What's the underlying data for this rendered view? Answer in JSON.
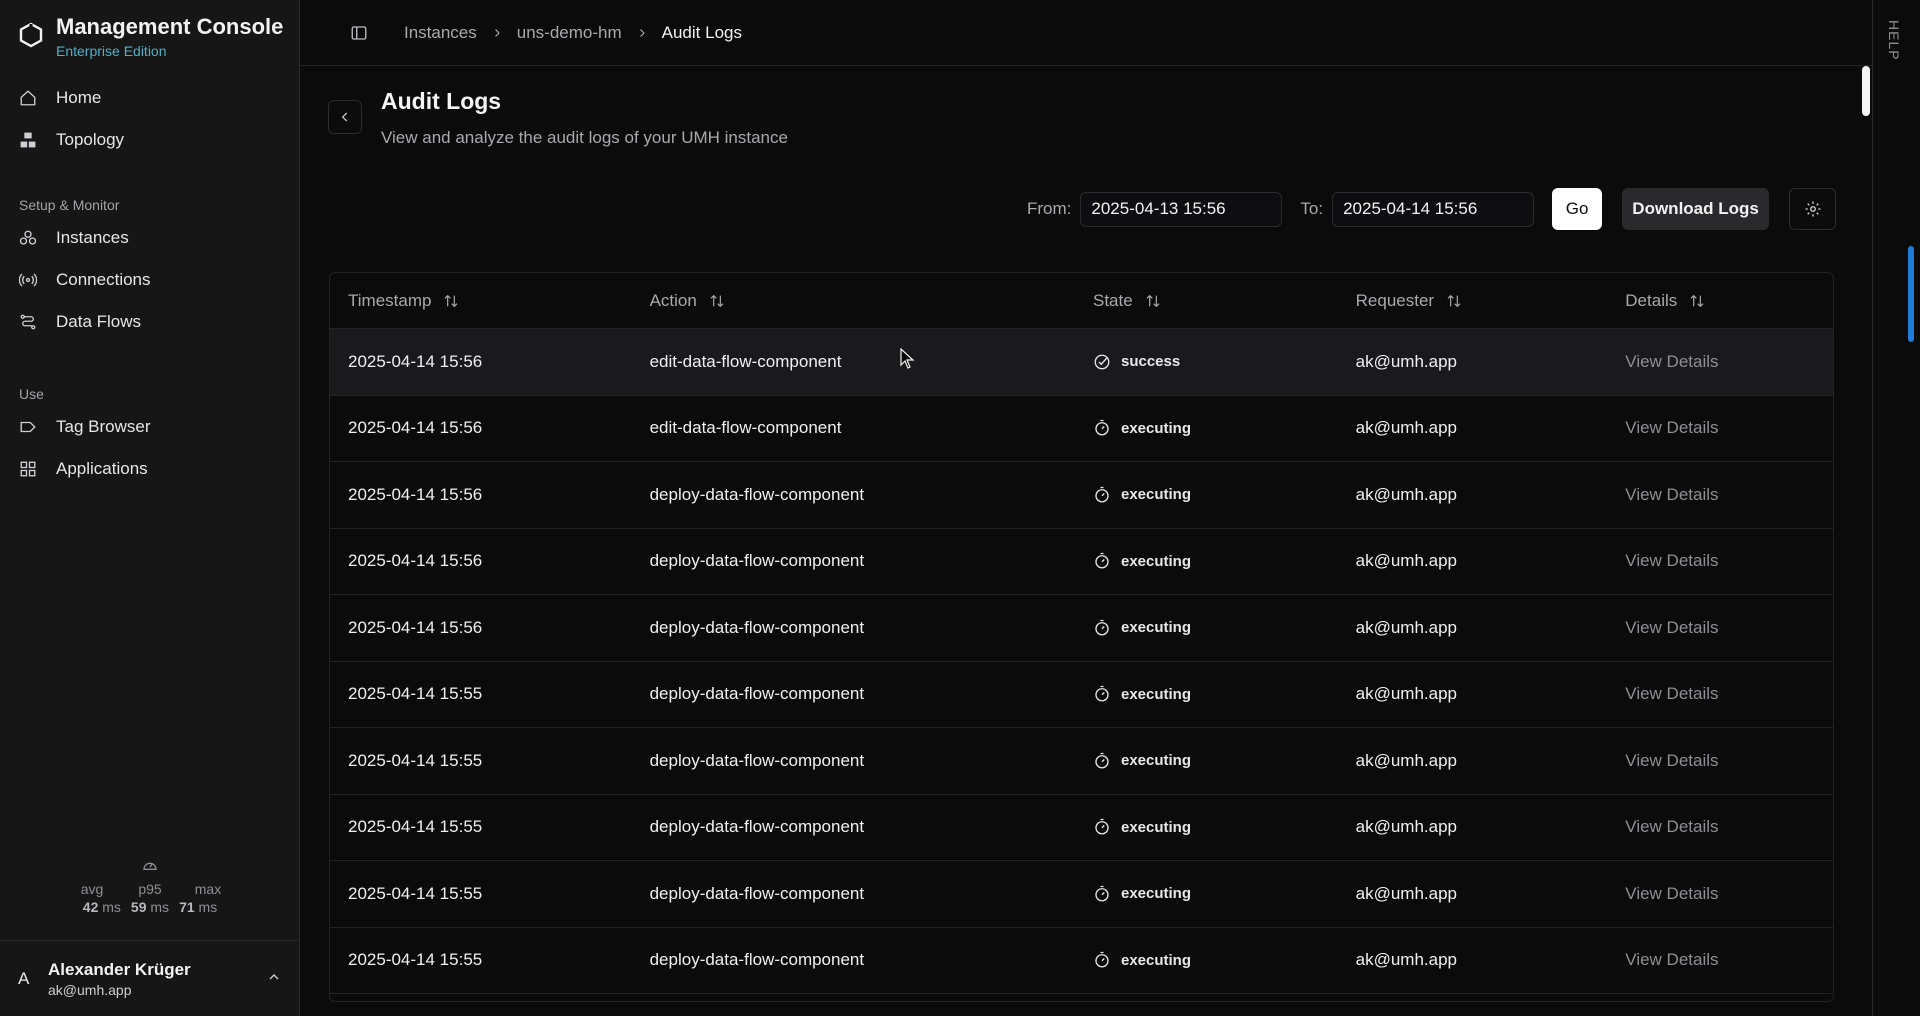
{
  "brand": {
    "title": "Management Console",
    "subtitle": "Enterprise Edition"
  },
  "nav": {
    "home": "Home",
    "topology": "Topology",
    "section_setup": "Setup & Monitor",
    "instances": "Instances",
    "connections": "Connections",
    "data_flows": "Data Flows",
    "section_use": "Use",
    "tag_browser": "Tag Browser",
    "applications": "Applications"
  },
  "latency": {
    "avg_label": "avg",
    "avg_value": "42",
    "avg_unit": "ms",
    "p95_label": "p95",
    "p95_value": "59",
    "p95_unit": "ms",
    "max_label": "max",
    "max_value": "71",
    "max_unit": "ms"
  },
  "user": {
    "initial": "A",
    "name": "Alexander Krüger",
    "email": "ak@umh.app"
  },
  "breadcrumb": {
    "item1": "Instances",
    "item2": "uns-demo-hm",
    "current": "Audit Logs"
  },
  "help": "HELP",
  "page": {
    "title": "Audit Logs",
    "description": "View and analyze the audit logs of your UMH instance"
  },
  "filters": {
    "from_label": "From:",
    "from_value": "2025-04-13 15:56",
    "to_label": "To:",
    "to_value": "2025-04-14 15:56",
    "go": "Go",
    "download": "Download Logs"
  },
  "table": {
    "headers": [
      "Timestamp",
      "Action",
      "State",
      "Requester",
      "Details"
    ],
    "rows": [
      {
        "timestamp": "2025-04-14 15:56",
        "action": "edit-data-flow-component",
        "state": "success",
        "requester": "ak@umh.app",
        "details": "View Details"
      },
      {
        "timestamp": "2025-04-14 15:56",
        "action": "edit-data-flow-component",
        "state": "executing",
        "requester": "ak@umh.app",
        "details": "View Details"
      },
      {
        "timestamp": "2025-04-14 15:56",
        "action": "deploy-data-flow-component",
        "state": "executing",
        "requester": "ak@umh.app",
        "details": "View Details"
      },
      {
        "timestamp": "2025-04-14 15:56",
        "action": "deploy-data-flow-component",
        "state": "executing",
        "requester": "ak@umh.app",
        "details": "View Details"
      },
      {
        "timestamp": "2025-04-14 15:56",
        "action": "deploy-data-flow-component",
        "state": "executing",
        "requester": "ak@umh.app",
        "details": "View Details"
      },
      {
        "timestamp": "2025-04-14 15:55",
        "action": "deploy-data-flow-component",
        "state": "executing",
        "requester": "ak@umh.app",
        "details": "View Details"
      },
      {
        "timestamp": "2025-04-14 15:55",
        "action": "deploy-data-flow-component",
        "state": "executing",
        "requester": "ak@umh.app",
        "details": "View Details"
      },
      {
        "timestamp": "2025-04-14 15:55",
        "action": "deploy-data-flow-component",
        "state": "executing",
        "requester": "ak@umh.app",
        "details": "View Details"
      },
      {
        "timestamp": "2025-04-14 15:55",
        "action": "deploy-data-flow-component",
        "state": "executing",
        "requester": "ak@umh.app",
        "details": "View Details"
      },
      {
        "timestamp": "2025-04-14 15:55",
        "action": "deploy-data-flow-component",
        "state": "executing",
        "requester": "ak@umh.app",
        "details": "View Details"
      }
    ]
  },
  "colors": {
    "accent": "#4fb0c6",
    "help_accent": "#1e7bd6",
    "background": "#0b0b0c",
    "sidebar": "#161617"
  }
}
